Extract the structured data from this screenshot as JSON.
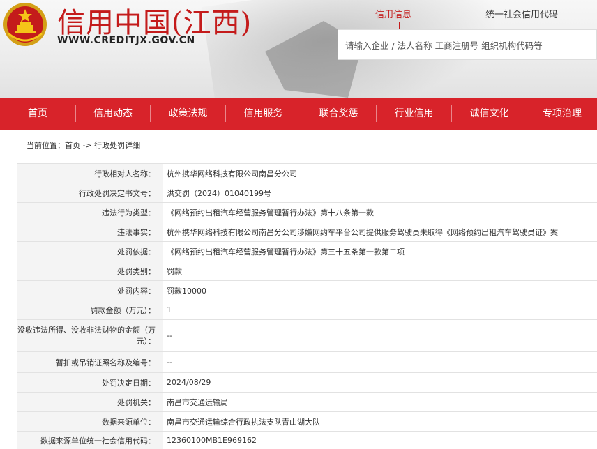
{
  "header": {
    "title": "信用中国(江西)",
    "url": "WWW.CREDITJX.GOV.CN",
    "tabs": [
      {
        "label": "信用信息",
        "active": true
      },
      {
        "label": "统一社会信用代码",
        "active": false
      }
    ],
    "search_placeholder": "请输入企业 / 法人名称 工商注册号 组织机构代码等"
  },
  "nav": {
    "items": [
      "首页",
      "信用动态",
      "政策法规",
      "信用服务",
      "联合奖惩",
      "行业信用",
      "诚信文化",
      "专项治理"
    ]
  },
  "breadcrumb": "当前位置：首页 -> 行政处罚详细",
  "detail": [
    {
      "label": "行政相对人名称：",
      "value": "杭州携华网络科技有限公司南昌分公司"
    },
    {
      "label": "行政处罚决定书文号：",
      "value": "洪交罚（2024）01040199号"
    },
    {
      "label": "违法行为类型：",
      "value": "《网络预约出租汽车经营服务管理暂行办法》第十八条第一款"
    },
    {
      "label": "违法事实：",
      "value": "杭州携华网络科技有限公司南昌分公司涉嫌网约车平台公司提供服务驾驶员未取得《网络预约出租汽车驾驶员证》案"
    },
    {
      "label": "处罚依据：",
      "value": "《网络预约出租汽车经营服务管理暂行办法》第三十五条第一款第二项"
    },
    {
      "label": "处罚类别：",
      "value": "罚款"
    },
    {
      "label": "处罚内容：",
      "value": "罚款10000"
    },
    {
      "label": "罚款金额（万元）：",
      "value": "1"
    },
    {
      "label": "没收违法所得、没收非法财物的金额（万元）：",
      "value": "--"
    },
    {
      "label": "暂扣或吊销证照名称及编号：",
      "value": "--"
    },
    {
      "label": "处罚决定日期：",
      "value": "2024/08/29"
    },
    {
      "label": "处罚机关：",
      "value": "南昌市交通运输局"
    },
    {
      "label": "数据来源单位：",
      "value": "南昌市交通运输综合行政执法支队青山湖大队"
    },
    {
      "label": "数据来源单位统一社会信用代码：",
      "value": "12360100MB1E969162"
    }
  ],
  "colors": {
    "brand_red": "#d8232a",
    "title_red": "#c41b1b"
  }
}
